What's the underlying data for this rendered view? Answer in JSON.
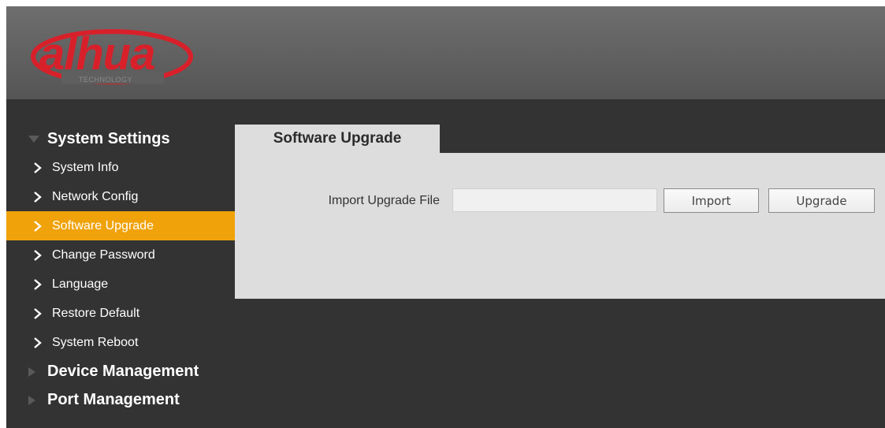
{
  "header": {
    "logo_text": "alhua",
    "logo_subtext": "TECHNOLOGY"
  },
  "sidebar": {
    "groups": [
      {
        "label": "System Settings",
        "expanded": true,
        "items": [
          {
            "label": "System Info",
            "active": false
          },
          {
            "label": "Network Config",
            "active": false
          },
          {
            "label": "Software Upgrade",
            "active": true
          },
          {
            "label": "Change Password",
            "active": false
          },
          {
            "label": "Language",
            "active": false
          },
          {
            "label": "Restore Default",
            "active": false
          },
          {
            "label": "System Reboot",
            "active": false
          }
        ]
      },
      {
        "label": "Device Management",
        "expanded": false
      },
      {
        "label": "Port Management",
        "expanded": false
      }
    ]
  },
  "main": {
    "tab_label": "Software Upgrade",
    "import_label": "Import Upgrade File",
    "file_value": "",
    "import_button": "Import",
    "upgrade_button": "Upgrade"
  },
  "icons": {
    "expanded_group": "triangle-down-icon",
    "collapsed_group": "triangle-right-icon",
    "sub_item": "chevron-right-icon"
  },
  "colors": {
    "header": "#5f5f5f",
    "background": "#333333",
    "active_item": "#f0a20a",
    "panel": "#dddddd",
    "logo_red": "#d8202a"
  }
}
